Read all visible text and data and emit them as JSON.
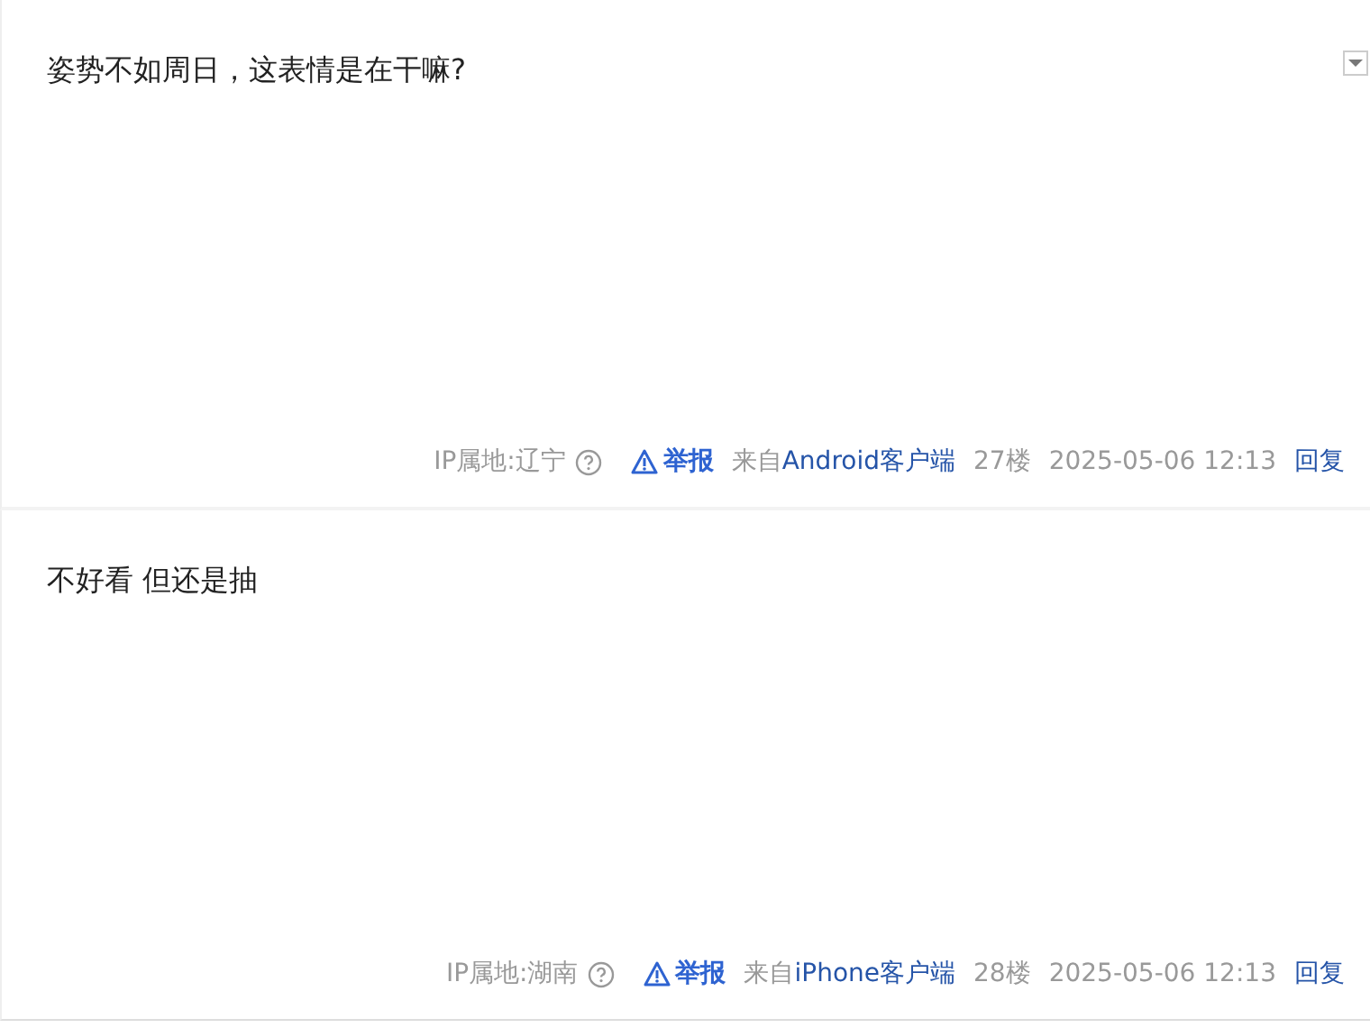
{
  "posts": [
    {
      "content": "姿势不如周日，这表情是在干嘛?",
      "menu": true,
      "ip": "IP属地:辽宁",
      "report": "举报",
      "source_prefix": "来自",
      "source": "Android客户端",
      "floor": "27楼",
      "time": "2025-05-06 12:13",
      "reply": "回复"
    },
    {
      "content": "不好看 但还是抽",
      "menu": false,
      "ip": "IP属地:湖南",
      "report": "举报",
      "source_prefix": "来自",
      "source": "iPhone客户端",
      "floor": "28楼",
      "time": "2025-05-06 12:13",
      "reply": "回复"
    }
  ]
}
